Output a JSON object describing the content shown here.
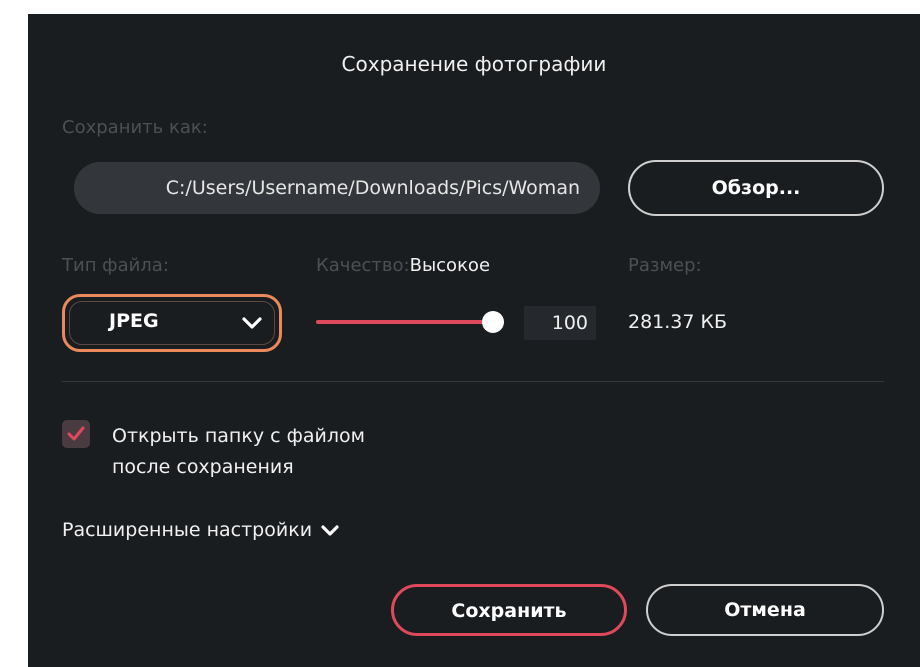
{
  "dialog": {
    "title": "Сохранение фотографии",
    "save_as_label": "Сохранить как:",
    "path_value": "C:/Users/Username/Downloads/Pics/Woman",
    "browse_label": "Обзор...",
    "file_type": {
      "label": "Тип файла:",
      "selected": "JPEG",
      "icon": "chevron-down-icon"
    },
    "quality": {
      "label": "Качество:",
      "level_text": "Высокое",
      "value": "100",
      "slider_fraction": 1.0
    },
    "size": {
      "label": "Размер:",
      "value": "281.37 КБ"
    },
    "open_folder": {
      "checked": true,
      "line1": "Открыть папку с файлом",
      "line2": "после сохранения"
    },
    "advanced_label": "Расширенные настройки",
    "save_label": "Сохранить",
    "cancel_label": "Отмена"
  },
  "colors": {
    "background": "#1a1d20",
    "accent_red": "#e0495c",
    "accent_orange": "#ea8a5c",
    "muted_text": "#4c4f54"
  }
}
